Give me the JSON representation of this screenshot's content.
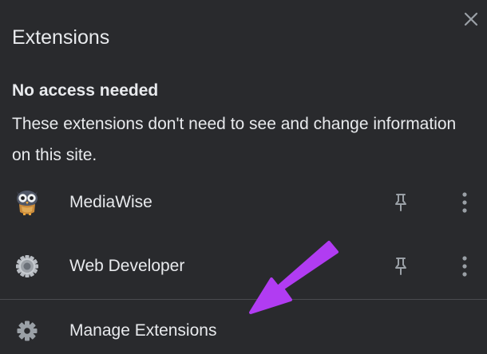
{
  "panel": {
    "title": "Extensions",
    "close_icon": "close-icon"
  },
  "section": {
    "heading": "No access needed",
    "description": "These extensions don't need to see and change information on this site."
  },
  "extensions": [
    {
      "name": "MediaWise",
      "icon": "owl-icon",
      "pin_icon": "pin-icon",
      "more_icon": "more-vert-icon"
    },
    {
      "name": "Web Developer",
      "icon": "gear-icon",
      "pin_icon": "pin-icon",
      "more_icon": "more-vert-icon"
    }
  ],
  "footer": {
    "manage_label": "Manage Extensions",
    "manage_icon": "settings-icon"
  },
  "colors": {
    "background": "#292a2d",
    "text": "#e8eaed",
    "icon": "#9aa0a6",
    "divider": "#4a4c50",
    "annotation_arrow": "#b13cf2"
  }
}
